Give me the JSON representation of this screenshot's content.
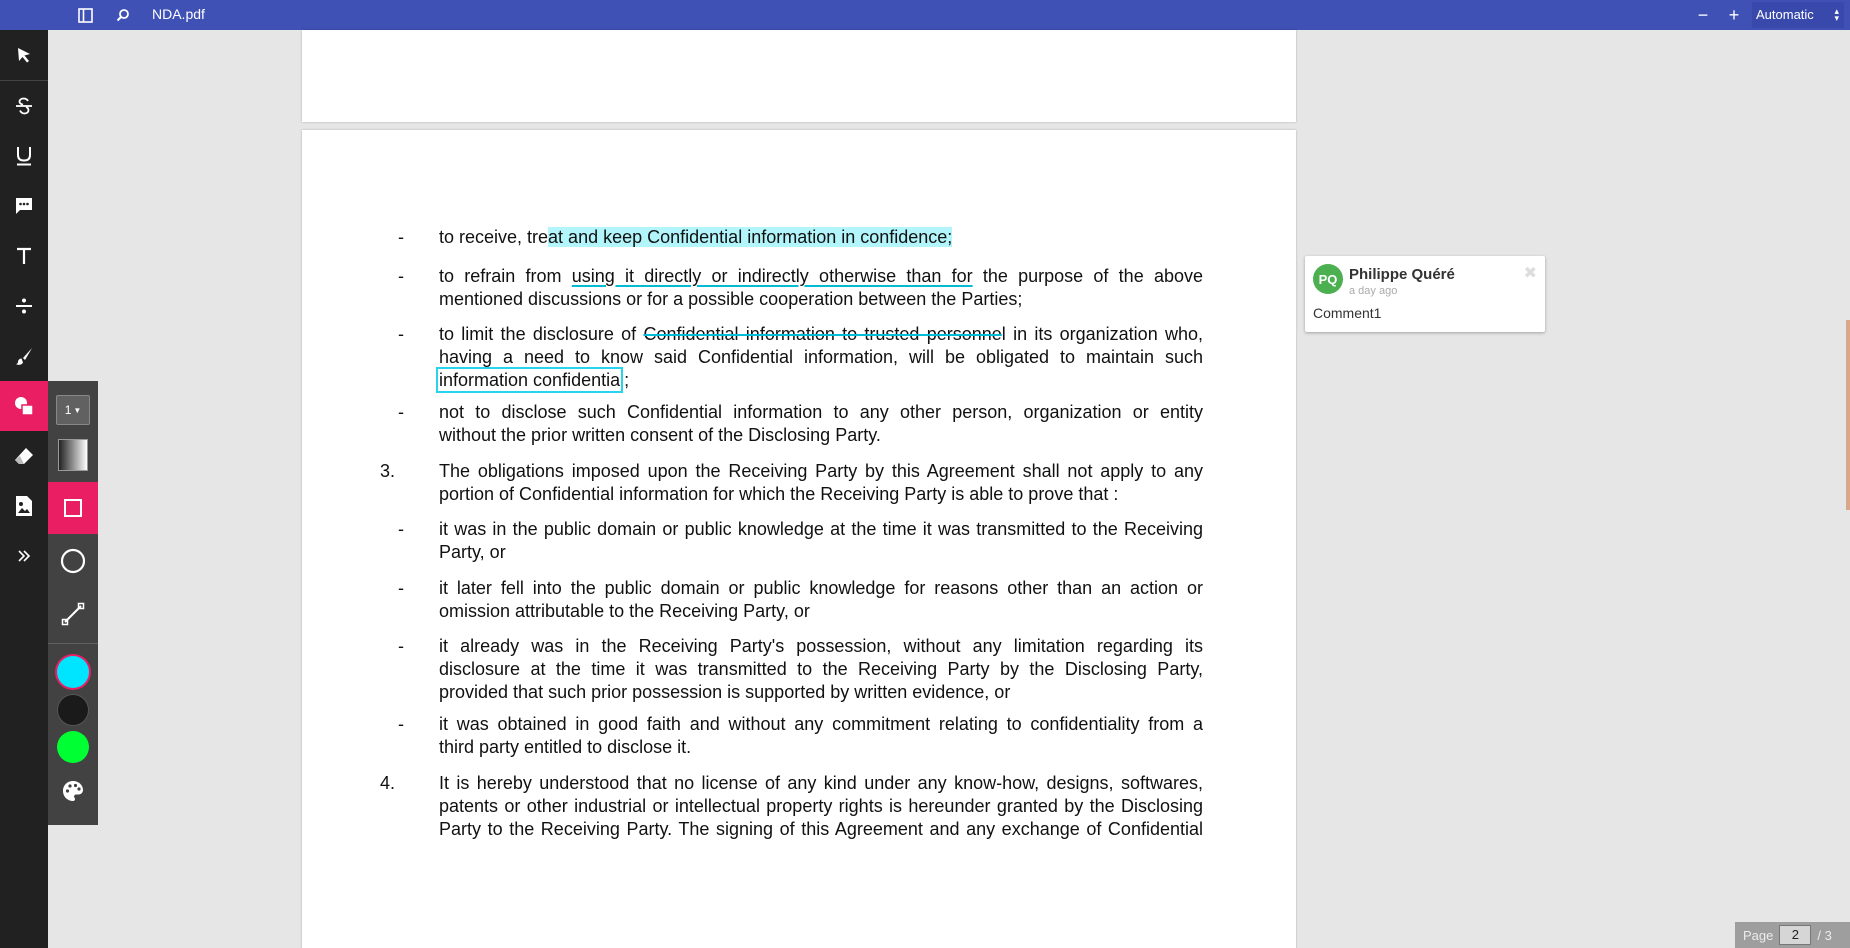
{
  "topbar": {
    "filename": "NDA.pdf",
    "zoom_out_label": "−",
    "zoom_in_label": "+",
    "zoom_value": "Automatic",
    "sidebar_toggle_icon": "sidebar-toggle-icon",
    "search_icon": "search-icon"
  },
  "toolbar": {
    "tools": [
      {
        "name": "pointer-tool",
        "icon": "cursor-arrow-icon"
      },
      {
        "name": "strikeout-tool",
        "icon": "strikethrough-icon"
      },
      {
        "name": "underline-tool",
        "icon": "underline-icon"
      },
      {
        "name": "comment-tool",
        "icon": "comment-icon"
      },
      {
        "name": "text-tool",
        "icon": "text-icon"
      },
      {
        "name": "divider-tool",
        "icon": "divide-icon"
      },
      {
        "name": "draw-tool",
        "icon": "brush-icon"
      },
      {
        "name": "shape-tool",
        "icon": "shapes-icon"
      },
      {
        "name": "eraser-tool",
        "icon": "eraser-icon"
      },
      {
        "name": "image-tool",
        "icon": "image-add-icon"
      },
      {
        "name": "expand-tool",
        "icon": "double-chevron-right-icon"
      }
    ],
    "active_tool": "shape-tool"
  },
  "shape_panel": {
    "size_value": "1",
    "shapes": [
      "rectangle",
      "circle",
      "line"
    ],
    "active_shape": "rectangle",
    "colors": [
      "#00e5ff",
      "#1a1a1a",
      "#00ff33"
    ],
    "selected_color": "#00e5ff",
    "palette_icon": "palette-icon"
  },
  "document": {
    "items": [
      {
        "marker": "-",
        "lines": [
          [
            {
              "t": "to receive, tre"
            },
            {
              "t": "at and keep Confidential information in confidence;",
              "s": "hl"
            }
          ]
        ]
      },
      {
        "marker": "-",
        "lines": [
          [
            {
              "t": "to refrain from "
            },
            {
              "t": "using it directly or indirectly otherwise than for",
              "s": "ul"
            },
            {
              "t": " the purpose of the above"
            }
          ],
          [
            {
              "t": "mentioned discussions or for a possible cooperation between the Parties;"
            }
          ]
        ]
      },
      {
        "marker": "-",
        "lines": [
          [
            {
              "t": "to limit the disclosure of "
            },
            {
              "t": "Confidential information to trusted personne",
              "s": "st"
            },
            {
              "t": "l in its organization who,"
            }
          ],
          [
            {
              "t": "having a need to know said Confidential information, will be obligated to maintain such"
            }
          ],
          [
            {
              "t": "information confidentia",
              "s": "box"
            },
            {
              "t": "l;"
            }
          ]
        ]
      },
      {
        "marker": "-",
        "lines": [
          [
            {
              "t": "not to disclose such Confidential information to any other person, organization or entity"
            }
          ],
          [
            {
              "t": "without the prior written consent of the Disclosing Party."
            }
          ]
        ]
      },
      {
        "marker": "3.",
        "lines": [
          [
            {
              "t": "The obligations imposed upon the Receiving Party by this Agreement shall not apply to any"
            }
          ],
          [
            {
              "t": "portion of Confidential information for which the Receiving Party is able to prove that :"
            }
          ]
        ]
      },
      {
        "marker": "-",
        "lines": [
          [
            {
              "t": "it was in the public domain or public knowledge at the time it was transmitted to the Receiving"
            }
          ],
          [
            {
              "t": "Party, or"
            }
          ]
        ]
      },
      {
        "marker": "-",
        "lines": [
          [
            {
              "t": "it later fell into the public domain or public knowledge for reasons other than an action or"
            }
          ],
          [
            {
              "t": "omission attributable to the Receiving Party, or"
            }
          ]
        ]
      },
      {
        "marker": "-",
        "lines": [
          [
            {
              "t": "it already was in the Receiving Party's possession, without any limitation regarding its"
            }
          ],
          [
            {
              "t": "disclosure at the time it was transmitted to the Receiving Party by the Disclosing Party,"
            }
          ],
          [
            {
              "t": "provided that such prior possession is supported by written evidence, or"
            }
          ]
        ]
      },
      {
        "marker": "-",
        "lines": [
          [
            {
              "t": "it was obtained in good faith and without any commitment relating to confidentiality from a"
            }
          ],
          [
            {
              "t": "third party entitled to disclose it."
            }
          ]
        ]
      },
      {
        "marker": "4.",
        "lines": [
          [
            {
              "t": "It is hereby understood that no license of any kind under any know-how, designs, softwares,"
            }
          ],
          [
            {
              "t": "patents or other industrial or intellectual property rights is hereunder granted by the Disclosing"
            }
          ],
          [
            {
              "t": "Party to the Receiving Party. The signing of this Agreement and any exchange of Confidential"
            }
          ]
        ]
      }
    ]
  },
  "comment": {
    "initials": "PQ",
    "author": "Philippe Quéré",
    "time": "a day ago",
    "text": "Comment1",
    "close_glyph": "✖",
    "avatar_color": "#4caf50"
  },
  "page_counter": {
    "label": "Page",
    "current": "2",
    "total": "/ 3"
  }
}
